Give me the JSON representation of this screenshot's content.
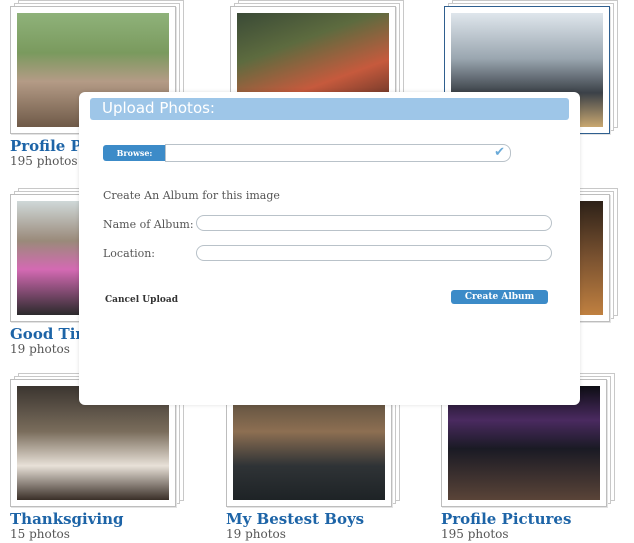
{
  "albums": [
    {
      "title": "Profile Pictures",
      "count": "195 photos"
    },
    {
      "title": "",
      "count": ""
    },
    {
      "title": "",
      "count": ""
    },
    {
      "title": "Good Times",
      "count": "19 photos"
    },
    {
      "title": "",
      "count": ""
    },
    {
      "title": "",
      "count": ""
    },
    {
      "title": "Thanksgiving",
      "count": "15 photos"
    },
    {
      "title": "My Bestest Boys",
      "count": "19 photos"
    },
    {
      "title": "Profile Pictures",
      "count": "195 photos"
    }
  ],
  "modal": {
    "title": "Upload Photos:",
    "browse_label": "Browse:",
    "browse_value": "",
    "section_label": "Create An Album for this image",
    "album_name_label": "Name of Album:",
    "album_name_value": "",
    "location_label": "Location:",
    "location_value": "",
    "cancel_label": "Cancel Upload",
    "create_label": "Create Album",
    "check_icon": "check-icon"
  },
  "colors": {
    "link": "#1d64a7",
    "header_bar": "#9ec6e8",
    "button": "#3c8bc8"
  }
}
